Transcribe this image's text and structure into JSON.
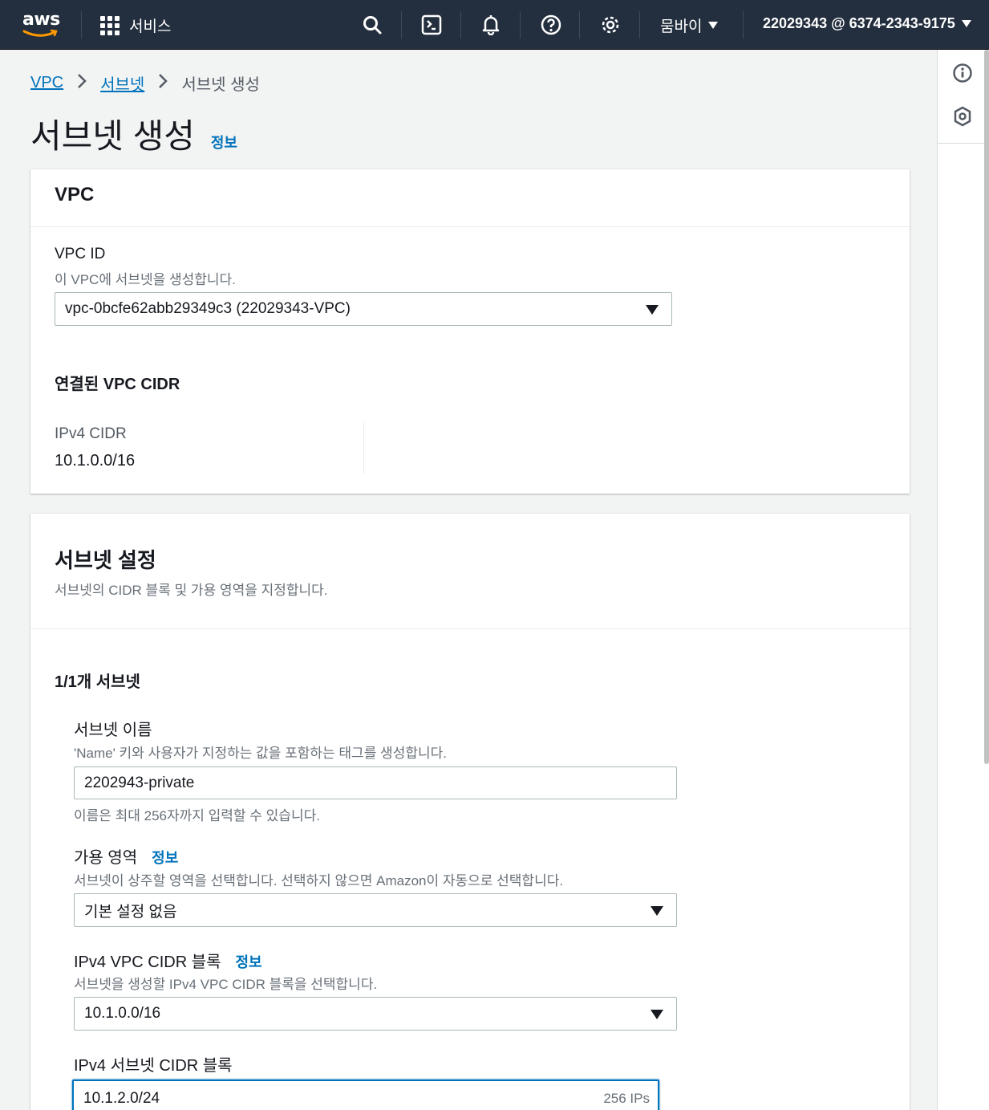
{
  "nav": {
    "logo": "aws",
    "services_label": "서비스",
    "region_label": "뭄바이",
    "account_label": "22029343 @ 6374-2343-9175"
  },
  "breadcrumb": {
    "items": [
      "VPC",
      "서브넷"
    ],
    "current": "서브넷 생성"
  },
  "page": {
    "title": "서브넷 생성",
    "info": "정보"
  },
  "vpc_section": {
    "heading": "VPC",
    "vpc_id_label": "VPC ID",
    "vpc_id_desc": "이 VPC에 서브넷을 생성합니다.",
    "vpc_id_value": "vpc-0bcfe62abb29349c3 (22029343-VPC)",
    "cidr_heading": "연결된 VPC CIDR",
    "ipv4_cidr_label": "IPv4 CIDR",
    "ipv4_cidr_value": "10.1.0.0/16"
  },
  "subnet_settings": {
    "heading": "서브넷 설정",
    "desc": "서브넷의 CIDR 블록 및 가용 영역을 지정합니다.",
    "count_label": "1/1개 서브넷",
    "name_label": "서브넷 이름",
    "name_desc": "'Name' 키와 사용자가 지정하는 값을 포함하는 태그를 생성합니다.",
    "name_value": "2202943-private",
    "name_hint": "이름은 최대 256자까지 입력할 수 있습니다.",
    "az_label": "가용 영역",
    "az_info": "정보",
    "az_desc": "서브넷이 상주할 영역을 선택합니다. 선택하지 않으면 Amazon이 자동으로 선택합니다.",
    "az_value": "기본 설정 없음",
    "vpc_cidr_label": "IPv4 VPC CIDR 블록",
    "vpc_cidr_info": "정보",
    "vpc_cidr_desc": "서브넷을 생성할 IPv4 VPC CIDR 블록을 선택합니다.",
    "vpc_cidr_value": "10.1.0.0/16",
    "subnet_cidr_label": "IPv4 서브넷 CIDR 블록",
    "subnet_cidr_value": "10.1.2.0/24",
    "subnet_cidr_ips": "256 IPs"
  }
}
